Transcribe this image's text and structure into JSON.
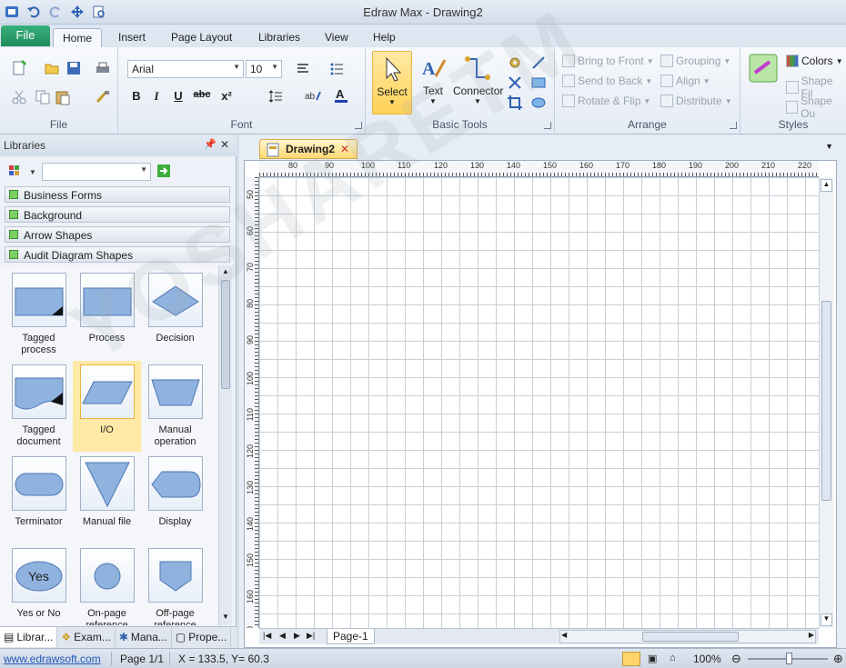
{
  "window": {
    "title": "Edraw Max - Drawing2"
  },
  "ribbon_tabs": {
    "file": "File",
    "home": "Home",
    "insert": "Insert",
    "page_layout": "Page Layout",
    "libraries": "Libraries",
    "view": "View",
    "help": "Help"
  },
  "groups": {
    "file": "File",
    "font": "Font",
    "basic_tools": "Basic Tools",
    "arrange": "Arrange",
    "styles": "Styles"
  },
  "font": {
    "family": "Arial",
    "size": "10",
    "bold": "B",
    "italic": "I",
    "underline": "U",
    "strike": "abc",
    "superscript": "x²"
  },
  "tools": {
    "select": "Select",
    "text": "Text",
    "connector": "Connector"
  },
  "arrange": {
    "bring_to_front": "Bring to Front",
    "send_to_back": "Send to Back",
    "rotate_flip": "Rotate & Flip",
    "grouping": "Grouping",
    "align": "Align",
    "distribute": "Distribute"
  },
  "styles": {
    "colors": "Colors",
    "shape_fill": "Shape Fil",
    "shape_outline": "Shape Ou"
  },
  "libraries": {
    "title": "Libraries",
    "categories": [
      "Business Forms",
      "Background",
      "Arrow Shapes",
      "Audit Diagram Shapes"
    ],
    "shapes": [
      {
        "l1": "Tagged",
        "l2": "process"
      },
      {
        "l1": "Process",
        "l2": ""
      },
      {
        "l1": "Decision",
        "l2": ""
      },
      {
        "l1": "Tagged",
        "l2": "document"
      },
      {
        "l1": "I/O",
        "l2": ""
      },
      {
        "l1": "Manual",
        "l2": "operation"
      },
      {
        "l1": "Terminator",
        "l2": ""
      },
      {
        "l1": "Manual file",
        "l2": ""
      },
      {
        "l1": "Display",
        "l2": ""
      },
      {
        "l1": "Yes or No",
        "l2": ""
      },
      {
        "l1": "On-page",
        "l2": "reference"
      },
      {
        "l1": "Off-page",
        "l2": "reference"
      }
    ],
    "yes_text": "Yes",
    "bottom_tabs": [
      "Librar...",
      "Exam...",
      "Mana...",
      "Prope..."
    ]
  },
  "document": {
    "tab": "Drawing2",
    "page_tab": "Page-1"
  },
  "rulers": {
    "h": [
      "80",
      "90",
      "100",
      "110",
      "120",
      "130",
      "140",
      "150",
      "160",
      "170",
      "180",
      "190",
      "200",
      "210",
      "220"
    ],
    "v": [
      "50",
      "60",
      "70",
      "80",
      "90",
      "100",
      "110",
      "120",
      "130",
      "140",
      "150",
      "160",
      "170"
    ]
  },
  "status": {
    "link": "www.edrawsoft.com",
    "page": "Page 1/1",
    "coords": "X = 133.5, Y= 60.3",
    "zoom": "100%"
  },
  "watermark": "YOSHARETM"
}
